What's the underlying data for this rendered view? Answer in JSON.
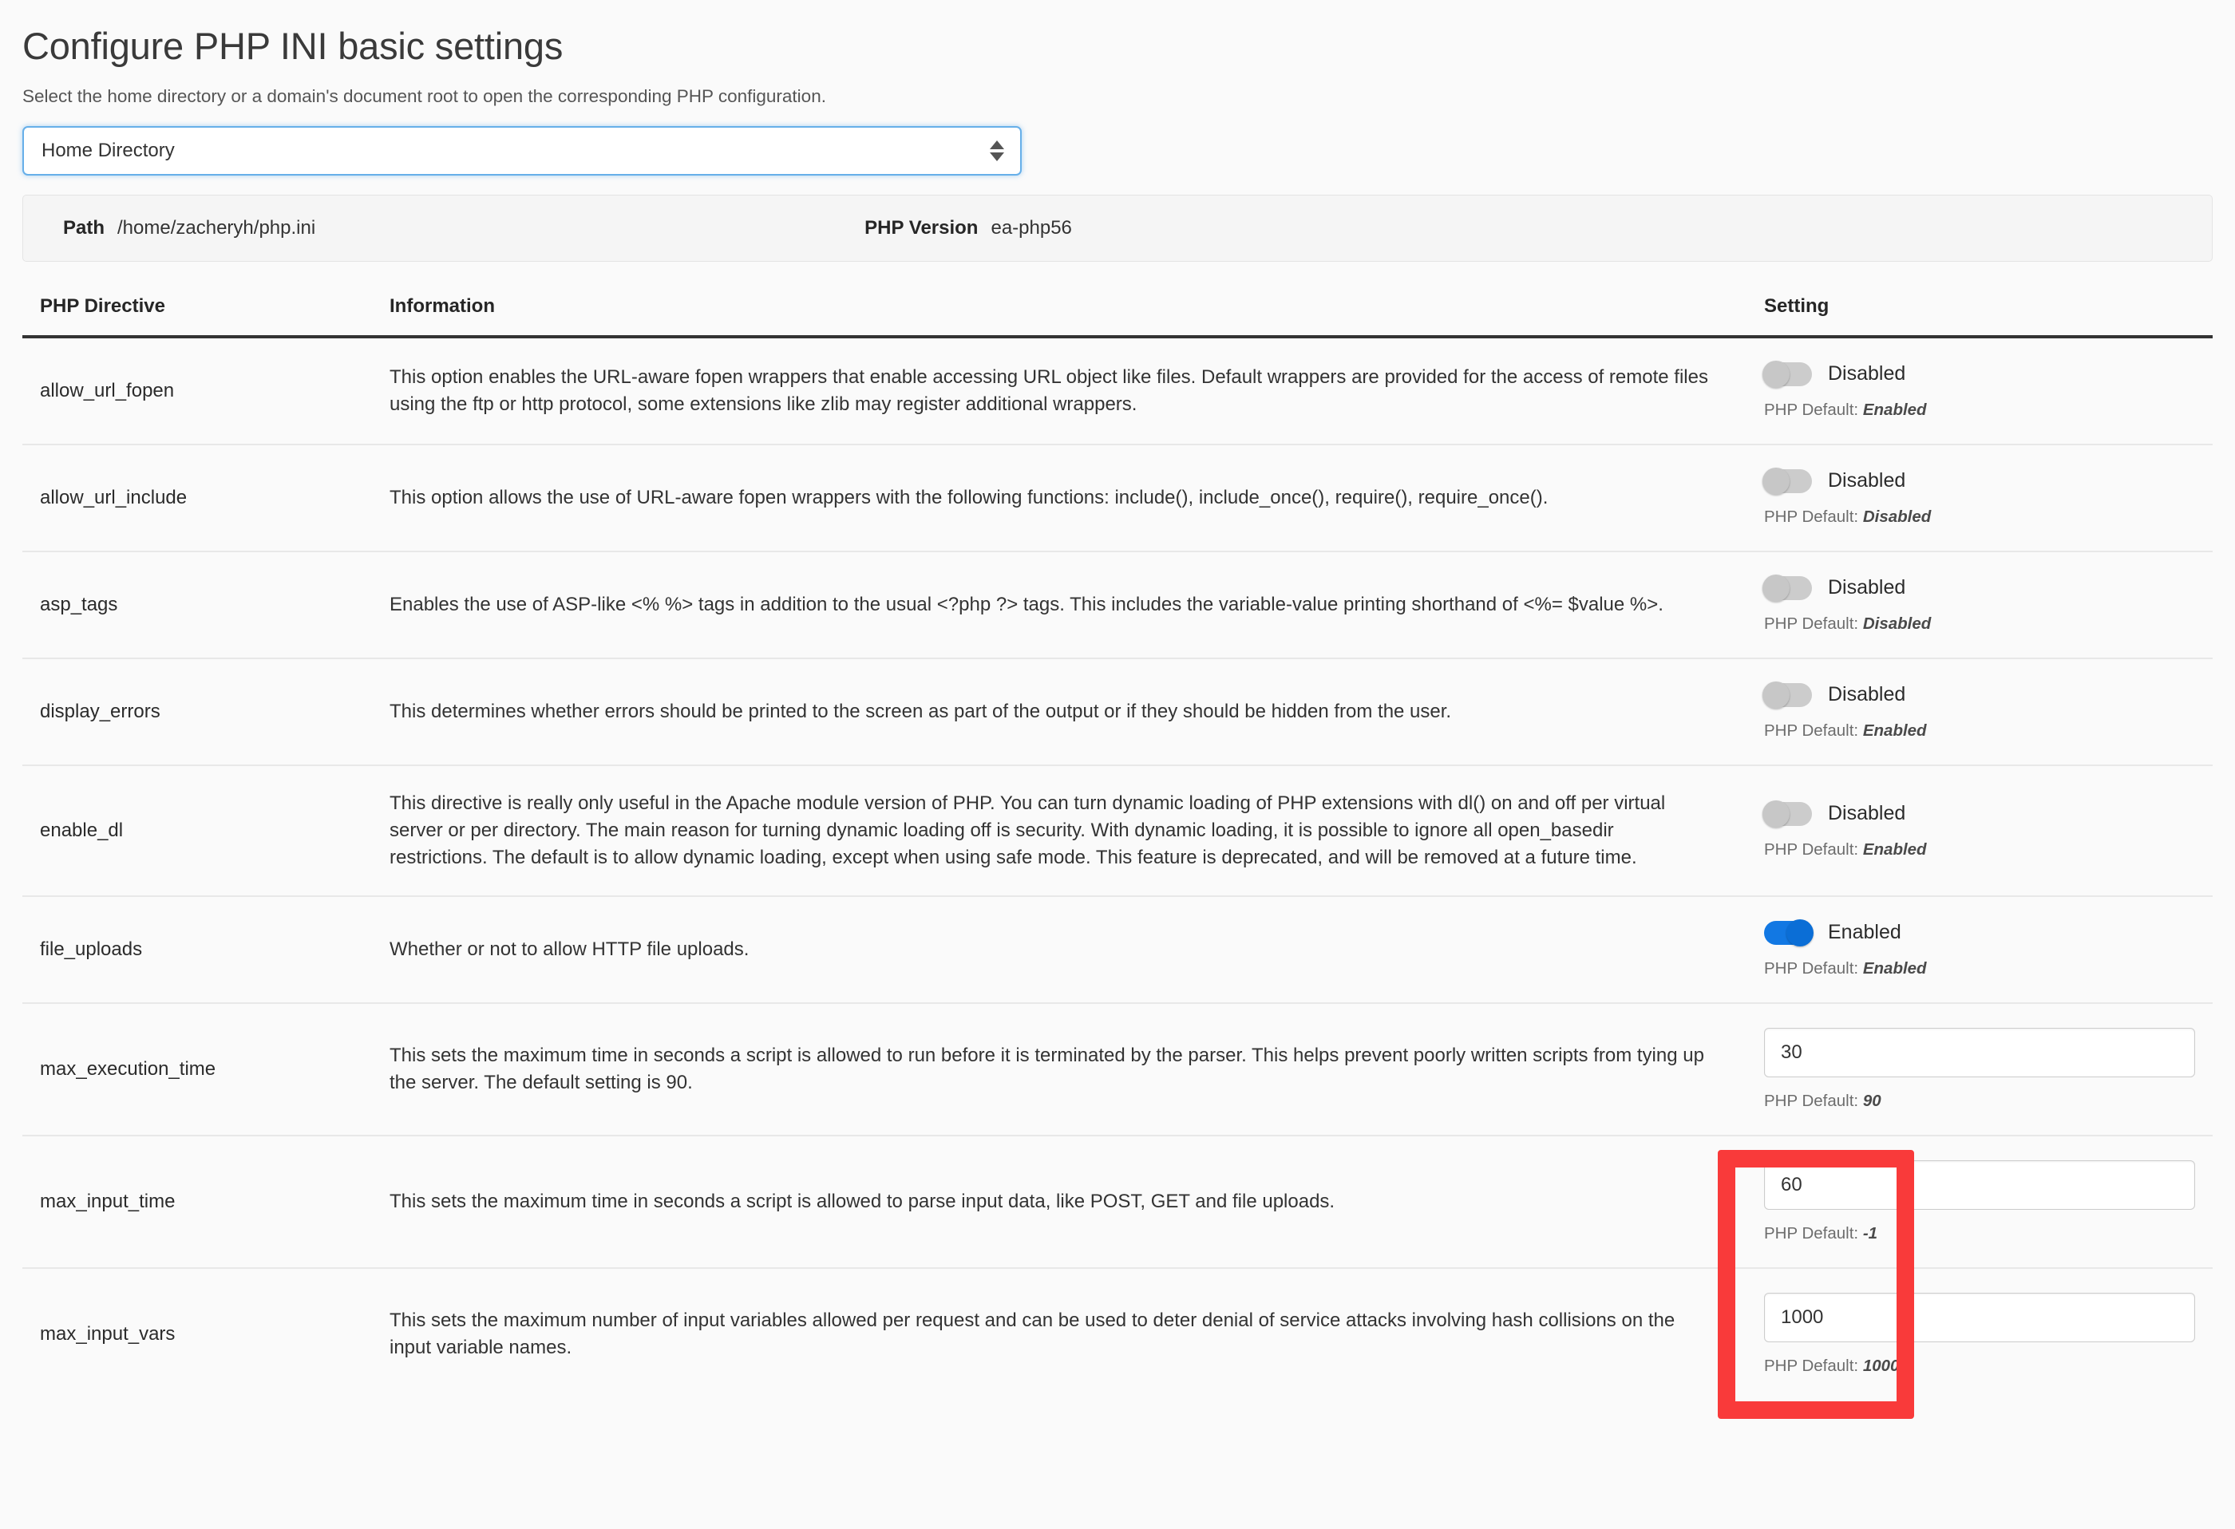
{
  "header": {
    "title": "Configure PHP INI basic settings",
    "subtitle": "Select the home directory or a domain's document root to open the corresponding PHP configuration."
  },
  "directory_select": {
    "value": "Home Directory",
    "icon": "updown-stepper-icon"
  },
  "info_bar": {
    "path_label": "Path",
    "path_value": "/home/zacheryh/php.ini",
    "version_label": "PHP Version",
    "version_value": "ea-php56"
  },
  "table": {
    "headers": {
      "directive": "PHP Directive",
      "information": "Information",
      "setting": "Setting"
    },
    "default_prefix": "PHP Default:",
    "rows": [
      {
        "directive": "allow_url_fopen",
        "information": "This option enables the URL-aware fopen wrappers that enable accessing URL object like files. Default wrappers are provided for the access of remote files using the ftp or http protocol, some extensions like zlib may register additional wrappers.",
        "control": "toggle",
        "state": "off",
        "state_label": "Disabled",
        "php_default": "Enabled"
      },
      {
        "directive": "allow_url_include",
        "information": "This option allows the use of URL-aware fopen wrappers with the following functions: include(), include_once(), require(), require_once().",
        "control": "toggle",
        "state": "off",
        "state_label": "Disabled",
        "php_default": "Disabled"
      },
      {
        "directive": "asp_tags",
        "information": "Enables the use of ASP-like <% %> tags in addition to the usual <?php ?> tags. This includes the variable-value printing shorthand of <%= $value %>.",
        "control": "toggle",
        "state": "off",
        "state_label": "Disabled",
        "php_default": "Disabled"
      },
      {
        "directive": "display_errors",
        "information": "This determines whether errors should be printed to the screen as part of the output or if they should be hidden from the user.",
        "control": "toggle",
        "state": "off",
        "state_label": "Disabled",
        "php_default": "Enabled"
      },
      {
        "directive": "enable_dl",
        "information": "This directive is really only useful in the Apache module version of PHP. You can turn dynamic loading of PHP extensions with dl() on and off per virtual server or per directory. The main reason for turning dynamic loading off is security. With dynamic loading, it is possible to ignore all open_basedir restrictions. The default is to allow dynamic loading, except when using safe mode. This feature is deprecated, and will be removed at a future time.",
        "control": "toggle",
        "state": "off",
        "state_label": "Disabled",
        "php_default": "Enabled"
      },
      {
        "directive": "file_uploads",
        "information": "Whether or not to allow HTTP file uploads.",
        "control": "toggle",
        "state": "on",
        "state_label": "Enabled",
        "php_default": "Enabled"
      },
      {
        "directive": "max_execution_time",
        "information": "This sets the maximum time in seconds a script is allowed to run before it is terminated by the parser. This helps prevent poorly written scripts from tying up the server. The default setting is 90.",
        "control": "input",
        "value": "30",
        "php_default": "90"
      },
      {
        "directive": "max_input_time",
        "information": "This sets the maximum time in seconds a script is allowed to parse input data, like POST, GET and file uploads.",
        "control": "input",
        "value": "60",
        "php_default": "-1"
      },
      {
        "directive": "max_input_vars",
        "information": "This sets the maximum number of input variables allowed per request and can be used to deter denial of service attacks involving hash collisions on the input variable names.",
        "control": "input",
        "value": "1000",
        "php_default": "1000"
      }
    ]
  },
  "annotation": {
    "color": "#f93a3a",
    "shape": "rectangle-highlight"
  }
}
